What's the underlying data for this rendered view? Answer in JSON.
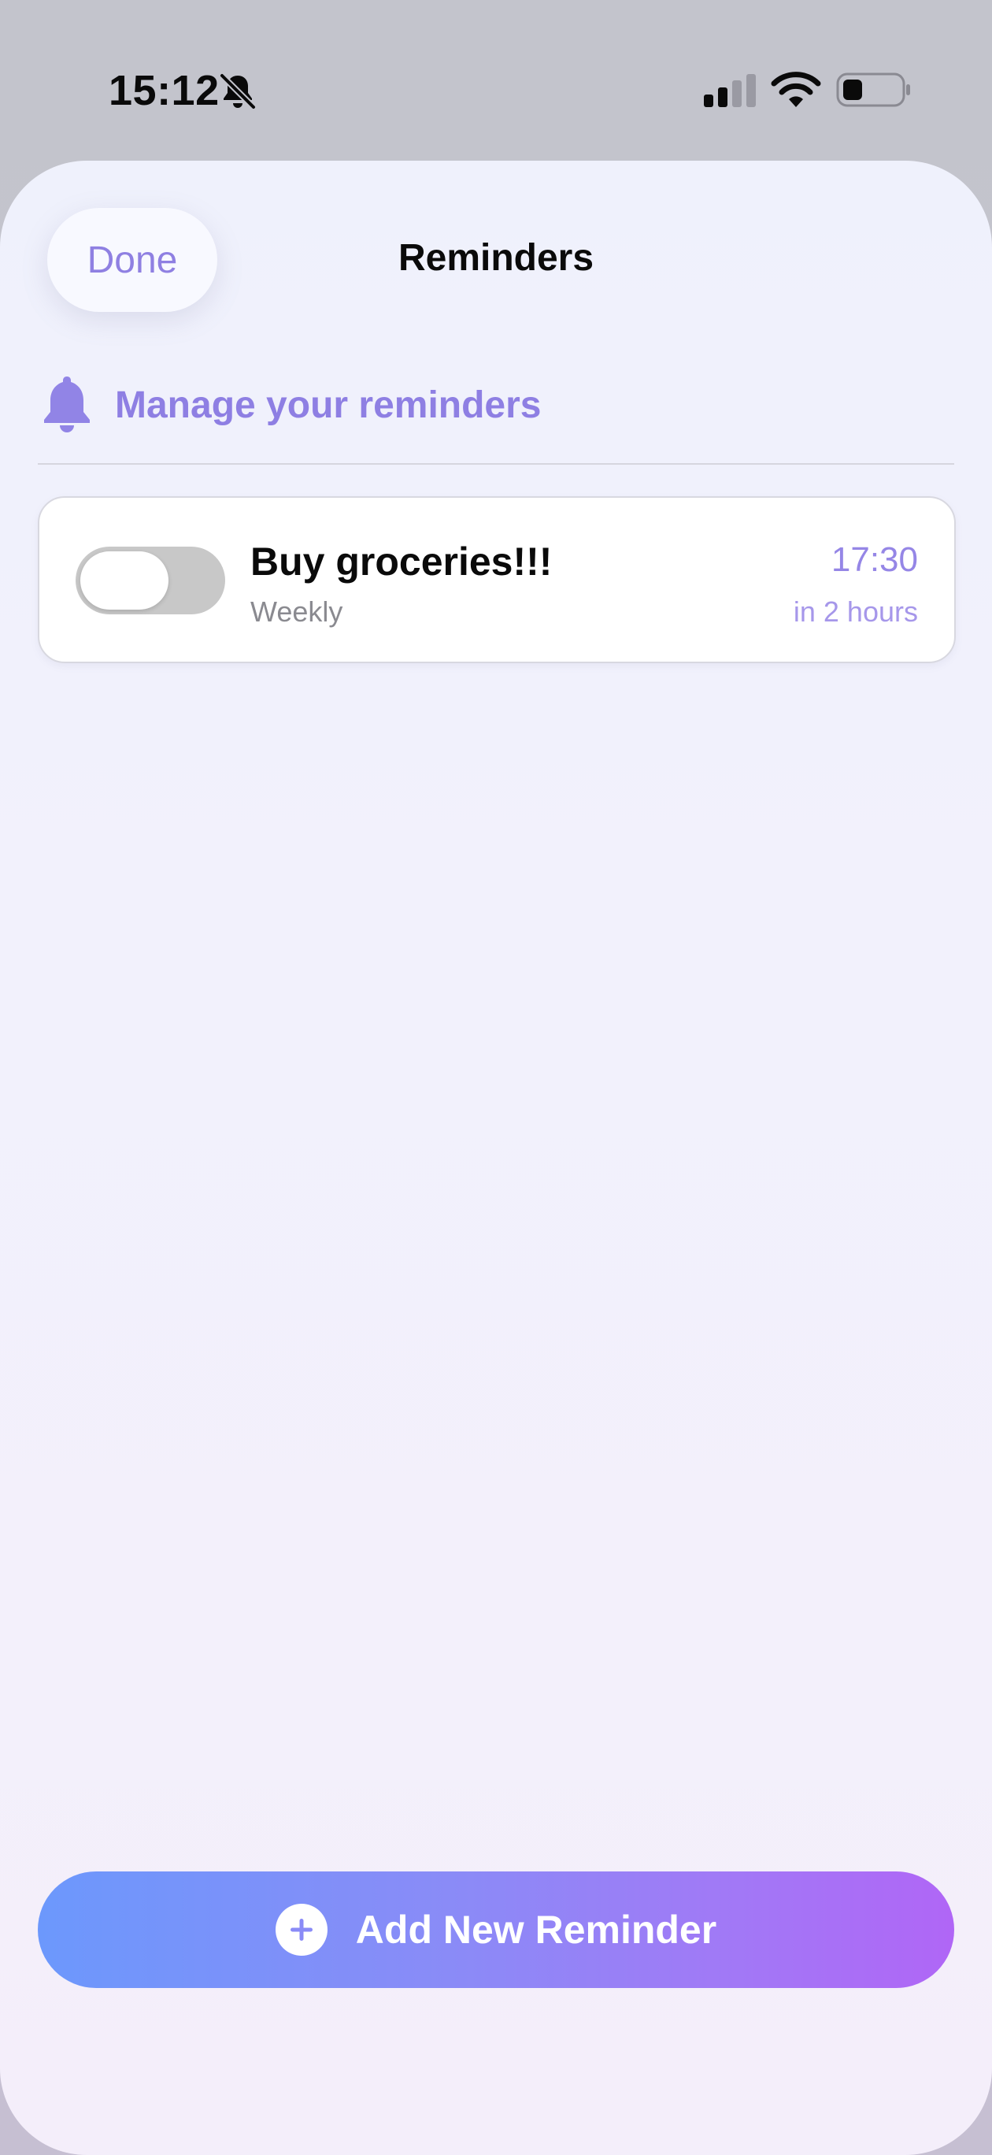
{
  "status_bar": {
    "time": "15:12",
    "icons": [
      "bell-slash-icon",
      "cellular-signal-icon",
      "wifi-icon",
      "battery-icon"
    ]
  },
  "sheet": {
    "done_label": "Done",
    "title": "Reminders"
  },
  "header": {
    "icon": "bell-icon",
    "text": "Manage your reminders"
  },
  "reminders": [
    {
      "title": "Buy groceries!!!",
      "repeat": "Weekly",
      "time": "17:30",
      "relative": "in 2 hours",
      "enabled": false
    }
  ],
  "add_button": {
    "icon": "plus-circle-icon",
    "label": "Add New Reminder"
  },
  "colors": {
    "accent": "#8e7fe3",
    "gradient_start": "#6c98fc",
    "gradient_end": "#b066f6",
    "toggle_off": "#c8c8c8"
  }
}
